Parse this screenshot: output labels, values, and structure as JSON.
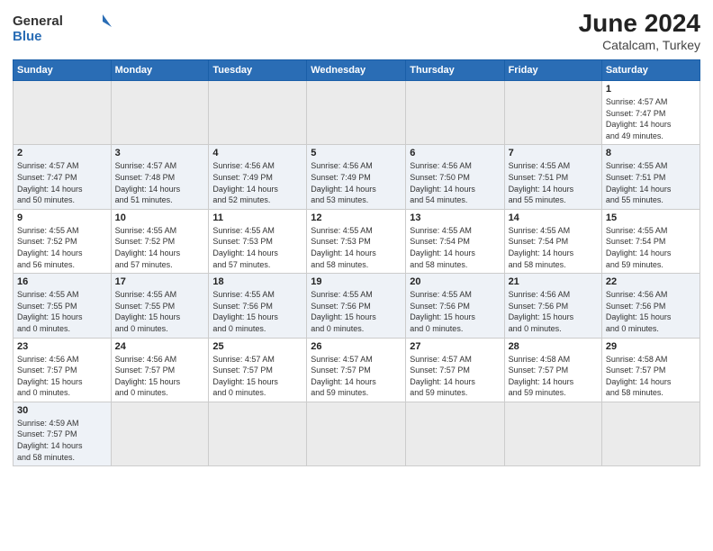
{
  "header": {
    "logo_general": "General",
    "logo_blue": "Blue",
    "month_year": "June 2024",
    "location": "Catalcam, Turkey"
  },
  "weekdays": [
    "Sunday",
    "Monday",
    "Tuesday",
    "Wednesday",
    "Thursday",
    "Friday",
    "Saturday"
  ],
  "weeks": [
    [
      {
        "day": "",
        "info": ""
      },
      {
        "day": "",
        "info": ""
      },
      {
        "day": "",
        "info": ""
      },
      {
        "day": "",
        "info": ""
      },
      {
        "day": "",
        "info": ""
      },
      {
        "day": "",
        "info": ""
      },
      {
        "day": "1",
        "info": "Sunrise: 4:57 AM\nSunset: 7:47 PM\nDaylight: 14 hours\nand 49 minutes."
      }
    ],
    [
      {
        "day": "2",
        "info": "Sunrise: 4:57 AM\nSunset: 7:47 PM\nDaylight: 14 hours\nand 50 minutes."
      },
      {
        "day": "3",
        "info": "Sunrise: 4:57 AM\nSunset: 7:48 PM\nDaylight: 14 hours\nand 51 minutes."
      },
      {
        "day": "4",
        "info": "Sunrise: 4:56 AM\nSunset: 7:49 PM\nDaylight: 14 hours\nand 52 minutes."
      },
      {
        "day": "5",
        "info": "Sunrise: 4:56 AM\nSunset: 7:49 PM\nDaylight: 14 hours\nand 53 minutes."
      },
      {
        "day": "6",
        "info": "Sunrise: 4:56 AM\nSunset: 7:50 PM\nDaylight: 14 hours\nand 54 minutes."
      },
      {
        "day": "7",
        "info": "Sunrise: 4:55 AM\nSunset: 7:51 PM\nDaylight: 14 hours\nand 55 minutes."
      },
      {
        "day": "8",
        "info": "Sunrise: 4:55 AM\nSunset: 7:51 PM\nDaylight: 14 hours\nand 55 minutes."
      }
    ],
    [
      {
        "day": "9",
        "info": "Sunrise: 4:55 AM\nSunset: 7:52 PM\nDaylight: 14 hours\nand 56 minutes."
      },
      {
        "day": "10",
        "info": "Sunrise: 4:55 AM\nSunset: 7:52 PM\nDaylight: 14 hours\nand 57 minutes."
      },
      {
        "day": "11",
        "info": "Sunrise: 4:55 AM\nSunset: 7:53 PM\nDaylight: 14 hours\nand 57 minutes."
      },
      {
        "day": "12",
        "info": "Sunrise: 4:55 AM\nSunset: 7:53 PM\nDaylight: 14 hours\nand 58 minutes."
      },
      {
        "day": "13",
        "info": "Sunrise: 4:55 AM\nSunset: 7:54 PM\nDaylight: 14 hours\nand 58 minutes."
      },
      {
        "day": "14",
        "info": "Sunrise: 4:55 AM\nSunset: 7:54 PM\nDaylight: 14 hours\nand 58 minutes."
      },
      {
        "day": "15",
        "info": "Sunrise: 4:55 AM\nSunset: 7:54 PM\nDaylight: 14 hours\nand 59 minutes."
      }
    ],
    [
      {
        "day": "16",
        "info": "Sunrise: 4:55 AM\nSunset: 7:55 PM\nDaylight: 15 hours\nand 0 minutes."
      },
      {
        "day": "17",
        "info": "Sunrise: 4:55 AM\nSunset: 7:55 PM\nDaylight: 15 hours\nand 0 minutes."
      },
      {
        "day": "18",
        "info": "Sunrise: 4:55 AM\nSunset: 7:56 PM\nDaylight: 15 hours\nand 0 minutes."
      },
      {
        "day": "19",
        "info": "Sunrise: 4:55 AM\nSunset: 7:56 PM\nDaylight: 15 hours\nand 0 minutes."
      },
      {
        "day": "20",
        "info": "Sunrise: 4:55 AM\nSunset: 7:56 PM\nDaylight: 15 hours\nand 0 minutes."
      },
      {
        "day": "21",
        "info": "Sunrise: 4:56 AM\nSunset: 7:56 PM\nDaylight: 15 hours\nand 0 minutes."
      },
      {
        "day": "22",
        "info": "Sunrise: 4:56 AM\nSunset: 7:56 PM\nDaylight: 15 hours\nand 0 minutes."
      }
    ],
    [
      {
        "day": "23",
        "info": "Sunrise: 4:56 AM\nSunset: 7:57 PM\nDaylight: 15 hours\nand 0 minutes."
      },
      {
        "day": "24",
        "info": "Sunrise: 4:56 AM\nSunset: 7:57 PM\nDaylight: 15 hours\nand 0 minutes."
      },
      {
        "day": "25",
        "info": "Sunrise: 4:57 AM\nSunset: 7:57 PM\nDaylight: 15 hours\nand 0 minutes."
      },
      {
        "day": "26",
        "info": "Sunrise: 4:57 AM\nSunset: 7:57 PM\nDaylight: 14 hours\nand 59 minutes."
      },
      {
        "day": "27",
        "info": "Sunrise: 4:57 AM\nSunset: 7:57 PM\nDaylight: 14 hours\nand 59 minutes."
      },
      {
        "day": "28",
        "info": "Sunrise: 4:58 AM\nSunset: 7:57 PM\nDaylight: 14 hours\nand 59 minutes."
      },
      {
        "day": "29",
        "info": "Sunrise: 4:58 AM\nSunset: 7:57 PM\nDaylight: 14 hours\nand 58 minutes."
      }
    ],
    [
      {
        "day": "30",
        "info": "Sunrise: 4:59 AM\nSunset: 7:57 PM\nDaylight: 14 hours\nand 58 minutes."
      },
      {
        "day": "",
        "info": ""
      },
      {
        "day": "",
        "info": ""
      },
      {
        "day": "",
        "info": ""
      },
      {
        "day": "",
        "info": ""
      },
      {
        "day": "",
        "info": ""
      },
      {
        "day": "",
        "info": ""
      }
    ]
  ]
}
